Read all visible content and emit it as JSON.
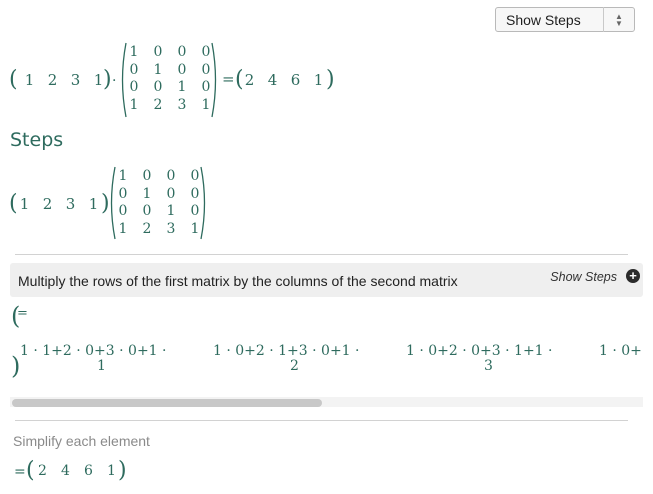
{
  "select": {
    "value": "Show Steps"
  },
  "equation": {
    "row_vector": [
      "1",
      "2",
      "3",
      "1"
    ],
    "matrix": [
      [
        "1",
        "0",
        "0",
        "0"
      ],
      [
        "0",
        "1",
        "0",
        "0"
      ],
      [
        "0",
        "0",
        "1",
        "0"
      ],
      [
        "1",
        "2",
        "3",
        "1"
      ]
    ],
    "result": [
      "2",
      "4",
      "6",
      "1"
    ],
    "dot": "·",
    "equals": "="
  },
  "steps": {
    "title": "Steps",
    "multiply": {
      "text": "Multiply the rows of the first matrix by the columns of the second matrix",
      "show_steps": "Show Steps",
      "items": [
        {
          "expr": "1 · 1+2 · 0+3 · 0+1 ·",
          "sub": "1"
        },
        {
          "expr": "1 · 0+2 · 1+3 · 0+1 ·",
          "sub": "2"
        },
        {
          "expr": "1 · 0+2 · 0+3 · 1+1 ·",
          "sub": "3"
        },
        {
          "expr": "1 · 0+",
          "sub": ""
        }
      ]
    },
    "simplify": {
      "text": "Simplify each element",
      "result": [
        "2",
        "4",
        "6",
        "1"
      ]
    }
  }
}
